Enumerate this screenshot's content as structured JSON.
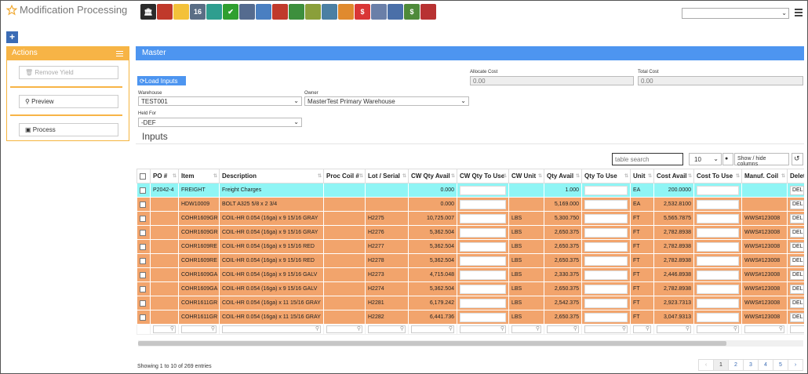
{
  "app": {
    "title": "Modification Processing"
  },
  "toolbar": {
    "icons": [
      {
        "name": "bank-icon",
        "color": "#2b2b2b",
        "glyph": "🏛"
      },
      {
        "name": "user-icon",
        "color": "#c0392b",
        "glyph": ""
      },
      {
        "name": "weather-icon",
        "color": "#f3c13a",
        "glyph": ""
      },
      {
        "name": "calendar-icon",
        "color": "#5a6e85",
        "glyph": "16"
      },
      {
        "name": "clock-icon",
        "color": "#2e9e8f",
        "glyph": ""
      },
      {
        "name": "check-icon",
        "color": "#2f9f2f",
        "glyph": "✔"
      },
      {
        "name": "card-icon",
        "color": "#556b8f",
        "glyph": ""
      },
      {
        "name": "magnifier-icon",
        "color": "#4a7fc1",
        "glyph": ""
      },
      {
        "name": "monitor-icon",
        "color": "#c0392b",
        "glyph": ""
      },
      {
        "name": "basket-icon",
        "color": "#3d8f3d",
        "glyph": ""
      },
      {
        "name": "box-icon",
        "color": "#8a9f3a",
        "glyph": ""
      },
      {
        "name": "house-icon",
        "color": "#4b7fa3",
        "glyph": ""
      },
      {
        "name": "coins-icon",
        "color": "#e08a2e",
        "glyph": ""
      },
      {
        "name": "dollar-chat-icon",
        "color": "#d93636",
        "glyph": "$"
      },
      {
        "name": "document-icon",
        "color": "#6a7fa8",
        "glyph": ""
      },
      {
        "name": "ruler-icon",
        "color": "#4a6fa8",
        "glyph": ""
      },
      {
        "name": "money-icon",
        "color": "#4e8a3a",
        "glyph": "$"
      },
      {
        "name": "dice-icon",
        "color": "#b83232",
        "glyph": ""
      }
    ]
  },
  "actions": {
    "title": "Actions",
    "remove_yield": "Remove Yield",
    "preview": "Preview",
    "process": "Process"
  },
  "master": {
    "title": "Master",
    "load_inputs": "Load Inputs",
    "allocate_cost_label": "Allocate Cost",
    "allocate_cost_value": "0.00",
    "total_cost_label": "Total Cost",
    "total_cost_value": "0.00",
    "warehouse_label": "Warehouse",
    "warehouse_value": "TEST001",
    "owner_label": "Owner",
    "owner_value": "MasterTest Primary Warehouse",
    "held_for_label": "Held For",
    "held_for_value": "-DEF"
  },
  "inputs": {
    "title": "Inputs",
    "search_placeholder": "table search",
    "page_size": "10",
    "show_hide": "Show / hide columns",
    "columns": [
      "PO #",
      "Item",
      "Description",
      "Proc Coil #",
      "Lot / Serial",
      "CW Qty Avail",
      "CW Qty To Use",
      "CW Unit",
      "Qty Avail",
      "Qty To Use",
      "Unit",
      "Cost Avail",
      "Cost To Use",
      "Manuf. Coil",
      "Delete"
    ],
    "rows": [
      {
        "po": "P2042-4",
        "item": "FREIGHT",
        "desc": "Freight Charges",
        "proc": "",
        "lot": "",
        "cw_avail": "0.000",
        "cw_unit": "",
        "qty_avail": "1.000",
        "unit": "EA",
        "cost_avail": "200.0000",
        "manuf": "",
        "del": "DEL",
        "hl": true
      },
      {
        "po": "",
        "item": "HDW10009",
        "desc": "BOLT A325 5/8 x 2 3/4",
        "proc": "",
        "lot": "",
        "cw_avail": "0.000",
        "cw_unit": "",
        "qty_avail": "5,169.000",
        "unit": "EA",
        "cost_avail": "2,532.8100",
        "manuf": "",
        "del": "DEL",
        "hl": false
      },
      {
        "po": "",
        "item": "COHR1609GR",
        "desc": "COIL-HR 0.054 (16ga) x 9 15/16 GRAY",
        "proc": "",
        "lot": "H2275",
        "cw_avail": "10,725.007",
        "cw_unit": "LBS",
        "qty_avail": "5,300.750",
        "unit": "FT",
        "cost_avail": "5,565.7875",
        "manuf": "WWS#123008",
        "del": "DEL",
        "hl": false
      },
      {
        "po": "",
        "item": "COHR1609GR",
        "desc": "COIL-HR 0.054 (16ga) x 9 15/16 GRAY",
        "proc": "",
        "lot": "H2276",
        "cw_avail": "5,362.504",
        "cw_unit": "LBS",
        "qty_avail": "2,650.375",
        "unit": "FT",
        "cost_avail": "2,782.8938",
        "manuf": "WWS#123008",
        "del": "DEL",
        "hl": false
      },
      {
        "po": "",
        "item": "COHR1609RE",
        "desc": "COIL-HR 0.054 (16ga) x 9 15/16 RED",
        "proc": "",
        "lot": "H2277",
        "cw_avail": "5,362.504",
        "cw_unit": "LBS",
        "qty_avail": "2,650.375",
        "unit": "FT",
        "cost_avail": "2,782.8938",
        "manuf": "WWS#123008",
        "del": "DEL",
        "hl": false
      },
      {
        "po": "",
        "item": "COHR1609RE",
        "desc": "COIL-HR 0.054 (16ga) x 9 15/16 RED",
        "proc": "",
        "lot": "H2278",
        "cw_avail": "5,362.504",
        "cw_unit": "LBS",
        "qty_avail": "2,650.375",
        "unit": "FT",
        "cost_avail": "2,782.8938",
        "manuf": "WWS#123008",
        "del": "DEL",
        "hl": false
      },
      {
        "po": "",
        "item": "COHR1609GA",
        "desc": "COIL-HR 0.054 (16ga) x 9 15/16 GALV",
        "proc": "",
        "lot": "H2273",
        "cw_avail": "4,715.048",
        "cw_unit": "LBS",
        "qty_avail": "2,330.375",
        "unit": "FT",
        "cost_avail": "2,446.8938",
        "manuf": "WWS#123008",
        "del": "DEL",
        "hl": false
      },
      {
        "po": "",
        "item": "COHR1609GA",
        "desc": "COIL-HR 0.054 (16ga) x 9 15/16 GALV",
        "proc": "",
        "lot": "H2274",
        "cw_avail": "5,362.504",
        "cw_unit": "LBS",
        "qty_avail": "2,650.375",
        "unit": "FT",
        "cost_avail": "2,782.8938",
        "manuf": "WWS#123008",
        "del": "DEL",
        "hl": false
      },
      {
        "po": "",
        "item": "COHR1611GR",
        "desc": "COIL-HR 0.054 (16ga) x 11 15/16 GRAY",
        "proc": "",
        "lot": "H2281",
        "cw_avail": "6,179.242",
        "cw_unit": "LBS",
        "qty_avail": "2,542.375",
        "unit": "FT",
        "cost_avail": "2,923.7313",
        "manuf": "WWS#123008",
        "del": "DEL",
        "hl": false
      },
      {
        "po": "",
        "item": "COHR1611GR",
        "desc": "COIL-HR 0.054 (16ga) x 11 15/16 GRAY",
        "proc": "",
        "lot": "H2282",
        "cw_avail": "6,441.736",
        "cw_unit": "LBS",
        "qty_avail": "2,650.375",
        "unit": "FT",
        "cost_avail": "3,047.9313",
        "manuf": "WWS#123008",
        "del": "DEL",
        "hl": false
      }
    ],
    "showing": "Showing 1 to 10 of 269 entries",
    "pages": [
      "‹",
      "1",
      "2",
      "3",
      "4",
      "5",
      "›"
    ]
  }
}
